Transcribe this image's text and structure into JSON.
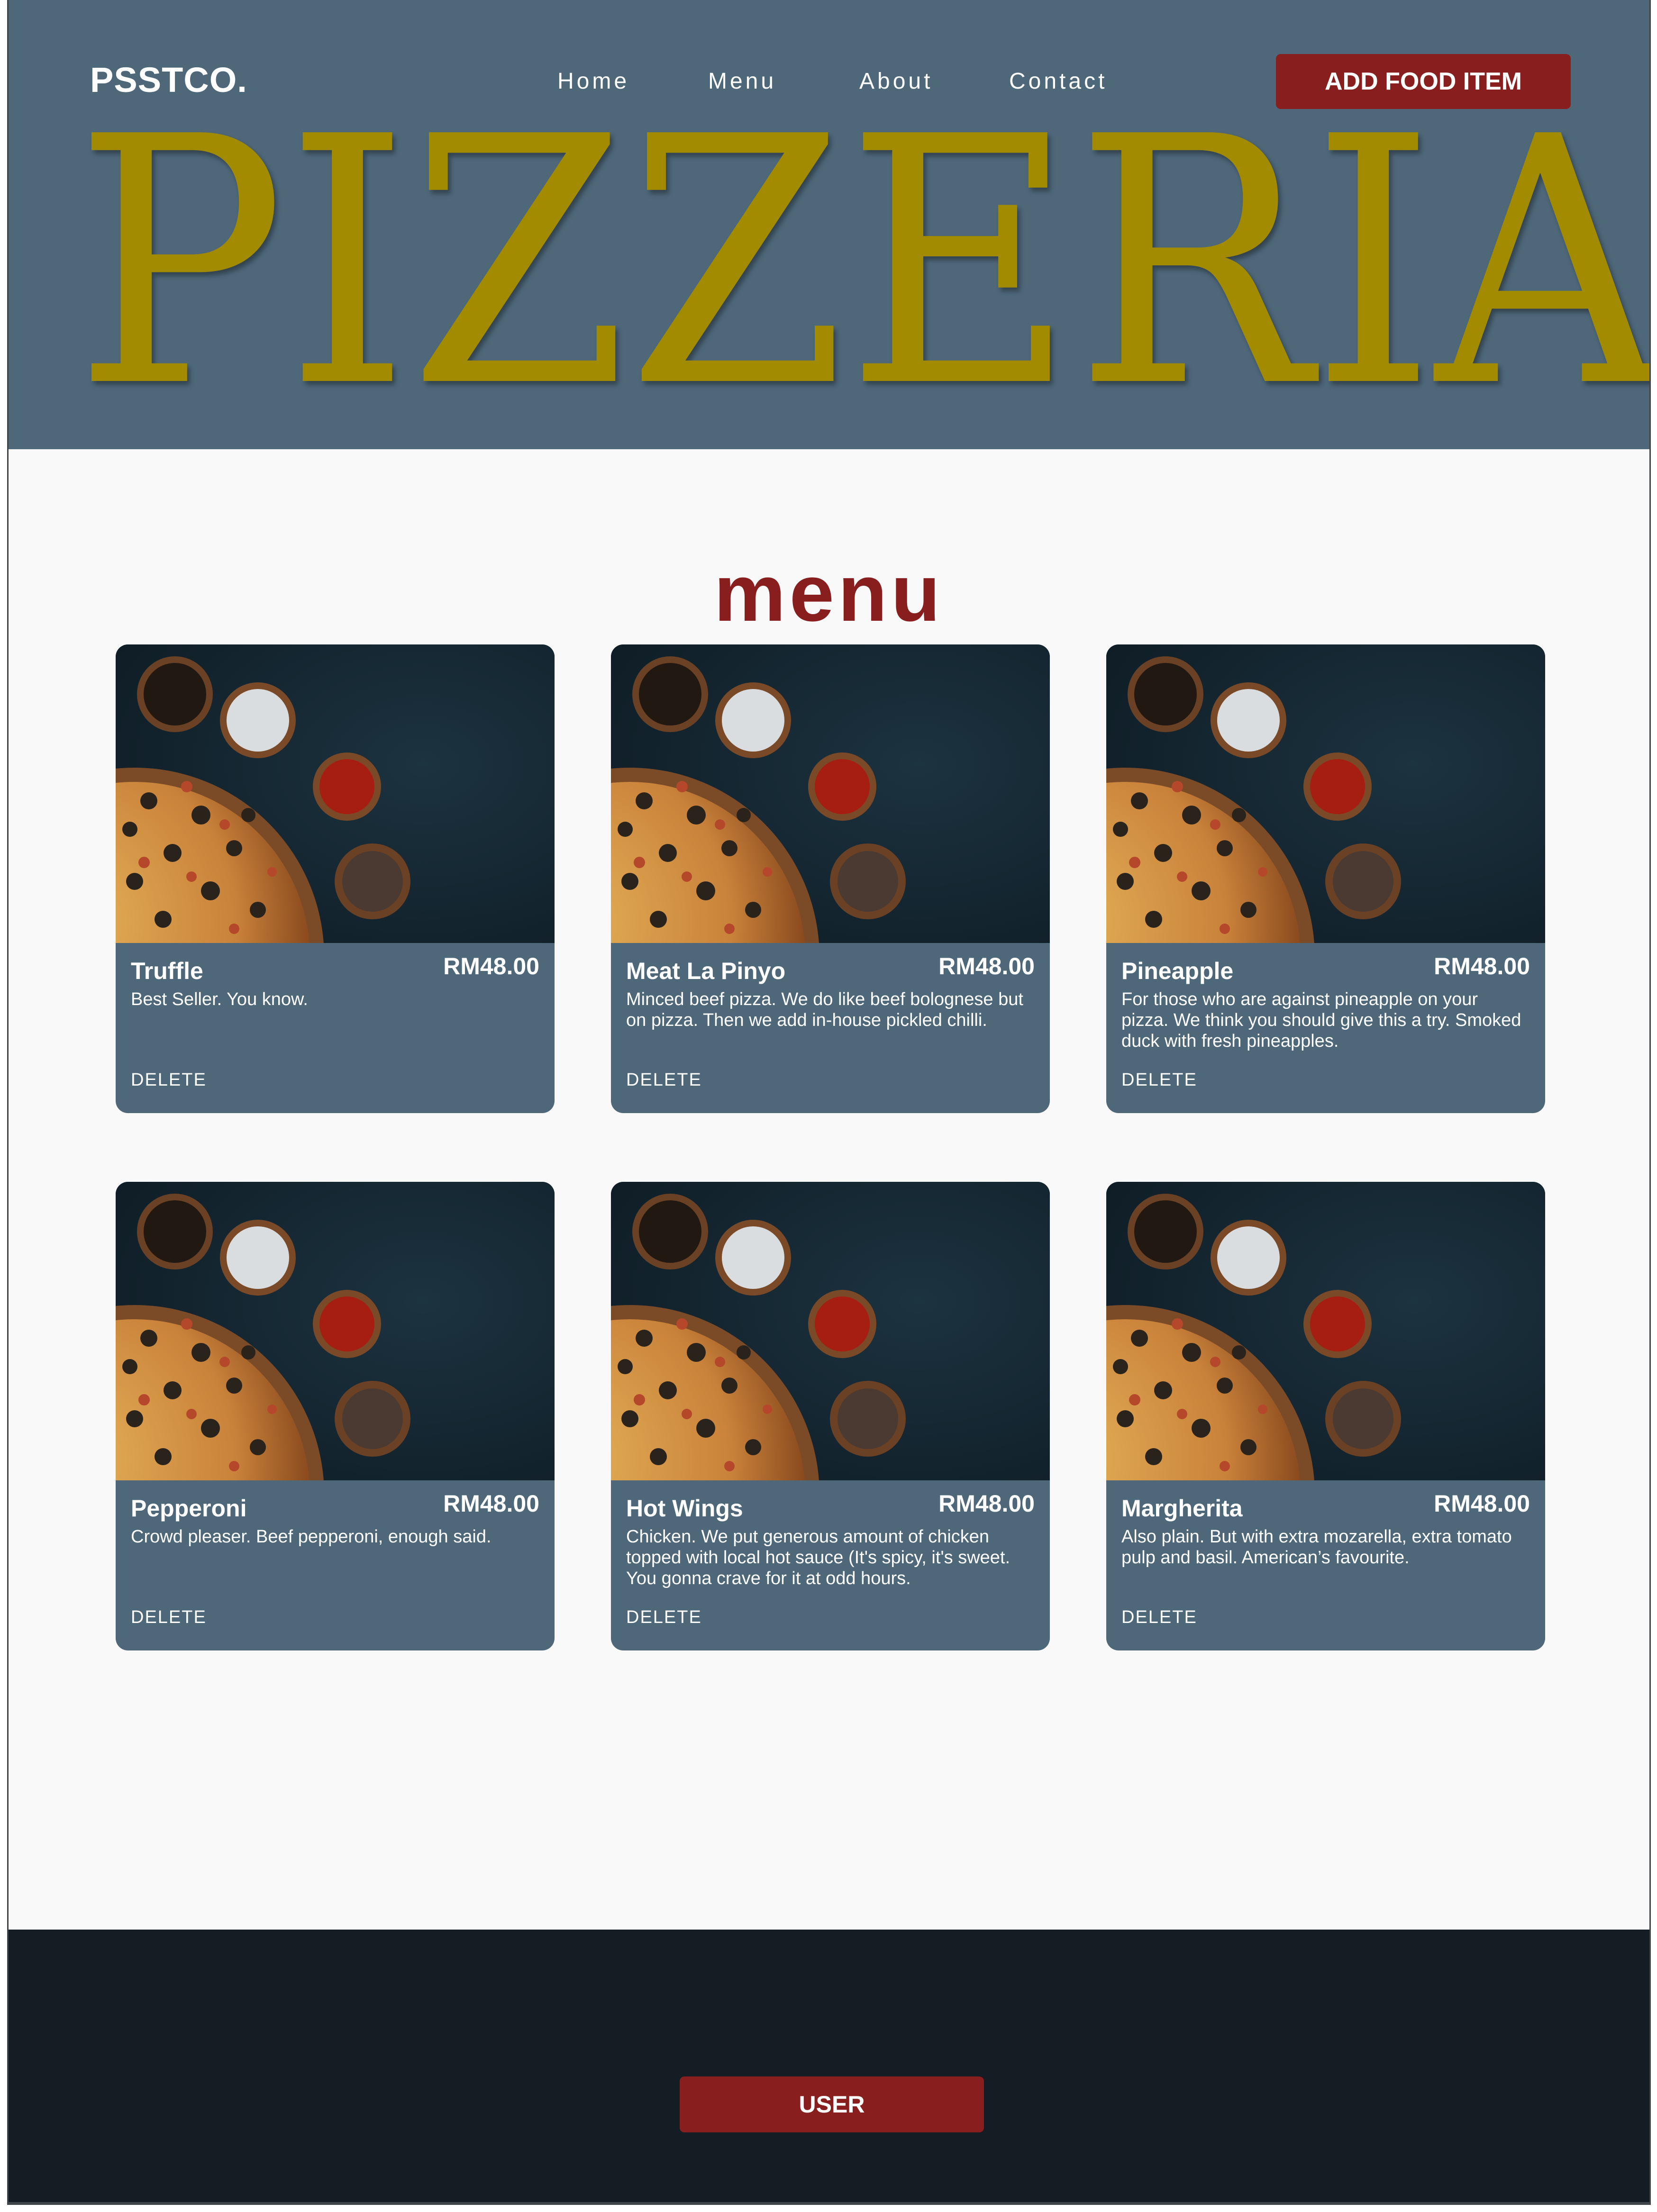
{
  "nav": {
    "logo": "PSSTCO.",
    "links": [
      "Home",
      "Menu",
      "About",
      "Contact"
    ],
    "add_button": "ADD FOOD ITEM"
  },
  "hero": {
    "title": "PIZZERIA"
  },
  "menu": {
    "heading": "menu",
    "delete_label": "DELETE",
    "items": [
      {
        "name": "Truffle",
        "price": "RM48.00",
        "description": "Best Seller. You know."
      },
      {
        "name": "Meat La Pinyo",
        "price": "RM48.00",
        "description": "Minced beef pizza. We do like beef bolognese but on pizza. Then we add in-house pickled chilli."
      },
      {
        "name": "Pineapple",
        "price": "RM48.00",
        "description": "For those who are against pineapple on your pizza. We think you should give this a try. Smoked duck with fresh pineapples."
      },
      {
        "name": "Pepperoni",
        "price": "RM48.00",
        "description": "Crowd pleaser. Beef pepperoni, enough said."
      },
      {
        "name": "Hot Wings",
        "price": "RM48.00",
        "description": "Chicken. We put generous amount of chicken topped with local hot sauce (It's spicy, it's sweet. You gonna crave for it at odd hours."
      },
      {
        "name": "Margherita",
        "price": "RM48.00",
        "description": "Also plain. But with extra mozarella, extra tomato pulp and basil. American’s favourite."
      }
    ]
  },
  "footer": {
    "user_button": "USER"
  },
  "colors": {
    "header_bg": "#4e6779",
    "accent_red": "#891e1f",
    "title_gold": "#a38b00",
    "footer_bg": "#141c24",
    "page_bg": "#f9f9f9"
  }
}
